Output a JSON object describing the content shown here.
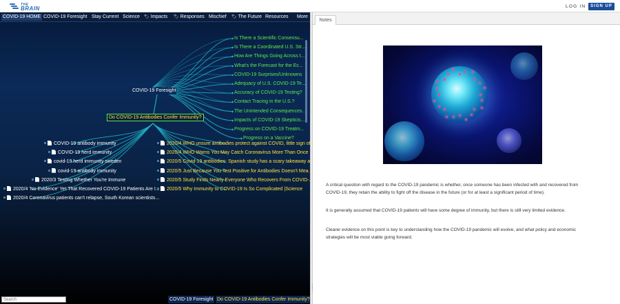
{
  "header": {
    "logo_top": "THE",
    "logo_main": "BRAIN",
    "login_label": "LOG IN",
    "signup_label": "SIGN UP"
  },
  "nav": {
    "items": [
      {
        "label": "COVID-19 HOME",
        "tagged": false
      },
      {
        "label": "COVID-19 Foresight",
        "tagged": false
      },
      {
        "label": "Stay Current",
        "tagged": false
      },
      {
        "label": "Science",
        "tagged": false
      },
      {
        "label": "Impacts",
        "tagged": true
      },
      {
        "label": "Responses",
        "tagged": true
      },
      {
        "label": "Mischief",
        "tagged": false
      },
      {
        "label": "The Future",
        "tagged": true
      },
      {
        "label": "Resources",
        "tagged": false
      },
      {
        "label": "More",
        "tagged": false
      }
    ]
  },
  "plex": {
    "focus": "COVID-19 Foresight",
    "active": "Do COVID-19 Antibodies Confer Immunity?",
    "jumps": [
      "Is There a Scientific Consensu...",
      "Is There a Coordinated U.S. Str...",
      "How Are Things Going Across t...",
      "What's the Forecast for the Ec...",
      "COVID-19 Surprises/Unknowns",
      "Adequacy of U.S. COVID-19 Te...",
      "Accuracy of COVID-19 Testing?",
      "Contact Tracing in the U.S.?",
      "The Unintended Consequences...",
      "Impacts of COVID-19 Skepticis...",
      "Progress on COVID-19 Treatm...",
      "Progress on a Vaccine?"
    ],
    "children_left": [
      "COVID-19 antibody immunity",
      "COVID-19 herd immunity",
      "covid-19 herd immunity sweden",
      "covid-19 antibody immunity",
      "2020/3 Testing Whether You're Immune",
      "2020/4 'No Evidence' Yet That Recovered COVID-19 Patients Are I...",
      "2020/4 Coronavirus patients can't relapse, South Korean scientists..."
    ],
    "children_right": [
      "2020/4 WHO unsure antibodies protect against COVID, little sign of...",
      "2020/4 WHO Warns You May Catch Coronavirus More Than Once",
      "2020/5 Covid-19 antibodies: Spanish study has a scary takeaway a...",
      "2020/5 Just Because You Test Positive for Antibodies Doesn't Mea...",
      "2020/5 Study Finds Nearly Everyone Who Recovers From COVID-...",
      "2020/5 Why Immunity to COVID-19 Is So Complicated |Science"
    ],
    "search_placeholder": "Search",
    "breadcrumb": [
      "COVID-19 Foresight",
      "Do COVID-19 Antibodies Confer Immunity?"
    ]
  },
  "notes": {
    "tab_label": "Notes",
    "paragraphs": [
      "A critical question with regard to the COVID-19 pandemic is whether, once someone has been infected with and recovered from COVID-19, they retain the ability to fight off the disease in the future (or for at least a significant period of time).",
      "It is generally assumed that COVID-19 patients will have some degree of immunity, but there is still very limited evidence.",
      "Clearer evidence on this point is key to understanding how the COVID-19 pandemic will evolve, and what policy and economic strategies will be most viable going forward."
    ]
  },
  "colors": {
    "jump_text": "#5eea4a",
    "active_text": "#ffe23a",
    "link_line": "#1fb8c8",
    "brand": "#1b4e9b"
  }
}
